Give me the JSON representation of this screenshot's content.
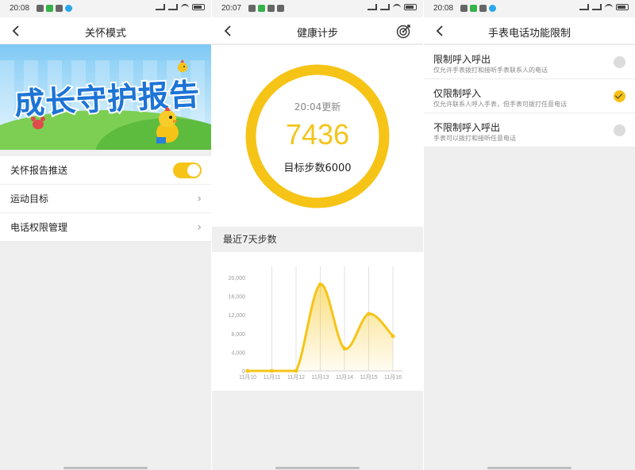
{
  "screens": [
    {
      "status_time": "20:08",
      "title": "关怀模式",
      "banner_text": "成长守护报告",
      "rows": [
        {
          "label": "关怀报告推送",
          "control": "toggle",
          "on": true
        },
        {
          "label": "运动目标",
          "control": "chevron"
        },
        {
          "label": "电话权限管理",
          "control": "chevron"
        }
      ],
      "chevron": "›"
    },
    {
      "status_time": "20:07",
      "title": "健康计步",
      "action_icon": "target-icon",
      "update_time": "20:04更新",
      "steps": "7436",
      "goal": "目标步数6000",
      "progress": 1.0,
      "section_title": "最近7天步数"
    },
    {
      "status_time": "20:08",
      "title": "手表电话功能限制",
      "options": [
        {
          "title": "限制呼入呼出",
          "desc": "仅允许手表拨打和接听手表联系人的电话",
          "selected": false
        },
        {
          "title": "仅限制呼入",
          "desc": "仅允许联系人呼入手表，但手表可拨打任意电话",
          "selected": true
        },
        {
          "title": "不限制呼入呼出",
          "desc": "手表可以拨打和接听任意电话",
          "selected": false
        }
      ]
    }
  ],
  "chart_data": {
    "type": "area",
    "categories": [
      "11月10",
      "11月11",
      "11月12",
      "11月13",
      "11月14",
      "11月15",
      "11月16"
    ],
    "values": [
      0,
      0,
      0,
      18500,
      4800,
      12200,
      7436
    ],
    "yticks": [
      "0",
      "4,000",
      "8,000",
      "12,000",
      "16,000",
      "20,000"
    ],
    "ylim": [
      0,
      20000
    ],
    "color": "#f6c417",
    "grid": "vertical"
  },
  "colors": {
    "accent": "#f6c417",
    "background": "#efefef",
    "card": "#ffffff"
  }
}
